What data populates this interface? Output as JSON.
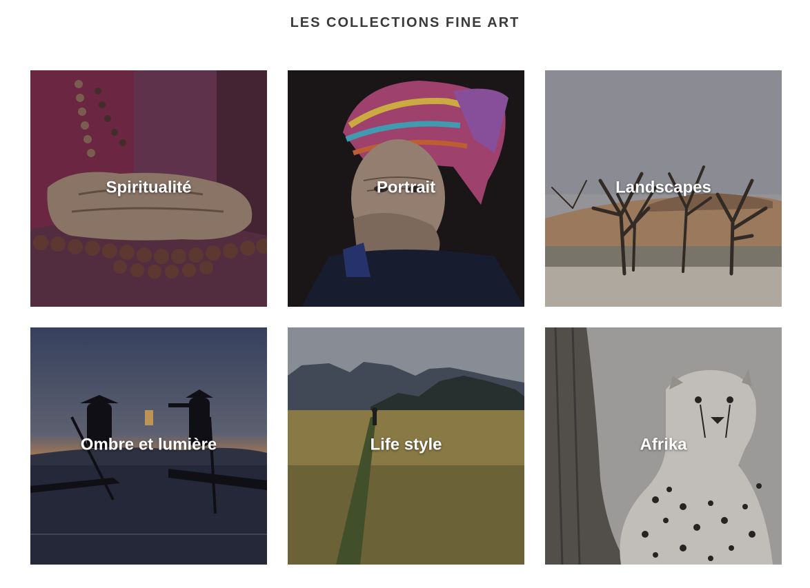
{
  "heading": "LES COLLECTIONS FINE ART",
  "collections": [
    {
      "label": "Spiritualité",
      "image": "hands-with-prayer-beads"
    },
    {
      "label": "Portrait",
      "image": "elderly-woman-with-colorful-turban"
    },
    {
      "label": "Landscapes",
      "image": "dead-trees-in-desert-dunes"
    },
    {
      "label": "Ombre et lumière",
      "image": "fishermen-silhouettes-at-dusk"
    },
    {
      "label": "Life style",
      "image": "person-walking-in-grass-field"
    },
    {
      "label": "Afrika",
      "image": "cheetah-black-and-white"
    }
  ]
}
